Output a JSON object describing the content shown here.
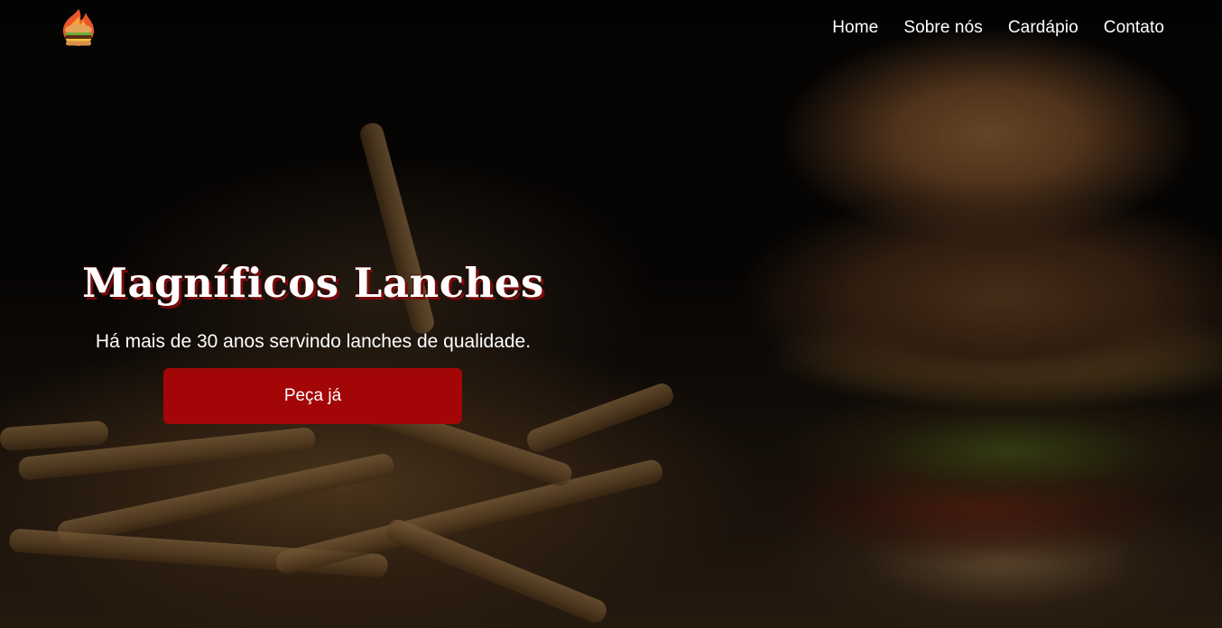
{
  "brand": {
    "logo_icon": "burger-fire-logo-icon"
  },
  "nav": {
    "items": [
      {
        "label": "Home"
      },
      {
        "label": "Sobre nós"
      },
      {
        "label": "Cardápio"
      },
      {
        "label": "Contato"
      }
    ]
  },
  "hero": {
    "title": "Magníficos Lanches",
    "subtitle": "Há mais de 30 anos servindo lanches de qualidade.",
    "cta_label": "Peça já",
    "background": "burger-and-fries-photo"
  },
  "colors": {
    "accent": "#a30606",
    "text": "#ffffff",
    "title_shadow": "#7a0a0a"
  }
}
